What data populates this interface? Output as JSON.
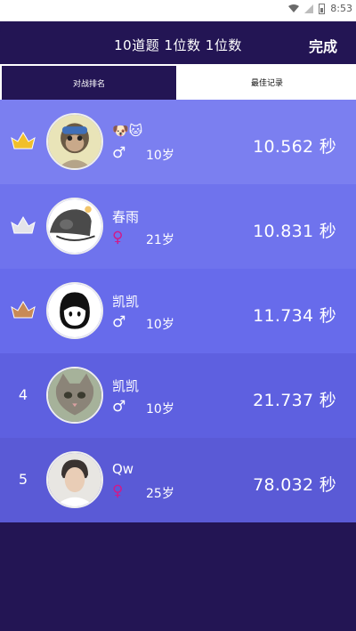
{
  "status_bar": {
    "time": "8:53",
    "icons": [
      "wifi-icon",
      "signal-icon",
      "battery-icon"
    ]
  },
  "header": {
    "title": "10道题 1位数 1位数",
    "done_label": "完成"
  },
  "tabs": [
    {
      "label": "对战排名",
      "active": true
    },
    {
      "label": "最佳记录",
      "active": false
    }
  ],
  "colors": {
    "background": "#231554",
    "row_colors": [
      "#7b7ff0",
      "#6f73ed",
      "#676beb",
      "#5e60e0",
      "#5a5ad6"
    ],
    "female_symbol": "#d01a8a",
    "crown_gold": "#f1bf2a",
    "crown_silver": "#e4e4ea",
    "crown_bronze": "#c88a55"
  },
  "rankings": [
    {
      "rank": "",
      "medal": "gold-crown-icon",
      "name": "🐶🐱",
      "gender_symbol": "♂",
      "gender": "male",
      "age": "10岁",
      "time": "10.562 秒",
      "avatar": "ape-avatar-icon"
    },
    {
      "rank": "",
      "medal": "silver-crown-icon",
      "name": "春雨",
      "gender_symbol": "♀",
      "gender": "female",
      "age": "21岁",
      "time": "10.831 秒",
      "avatar": "cartoon-avatar-icon"
    },
    {
      "rank": "",
      "medal": "bronze-crown-icon",
      "name": "凯凯",
      "gender_symbol": "♂",
      "gender": "male",
      "age": "10岁",
      "time": "11.734 秒",
      "avatar": "smiley-avatar-icon"
    },
    {
      "rank": "4",
      "medal": "",
      "name": "凯凯",
      "gender_symbol": "♂",
      "gender": "male",
      "age": "10岁",
      "time": "21.737 秒",
      "avatar": "kitten-avatar-icon"
    },
    {
      "rank": "5",
      "medal": "",
      "name": "Qw",
      "gender_symbol": "♀",
      "gender": "female",
      "age": "25岁",
      "time": "78.032 秒",
      "avatar": "portrait-avatar-icon"
    }
  ]
}
